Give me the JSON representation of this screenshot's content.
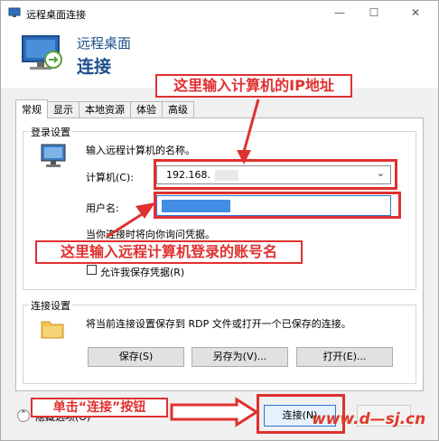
{
  "window": {
    "title": "远程桌面连接",
    "controls": {
      "minimize": "—",
      "maximize": "☐",
      "close": "✕"
    }
  },
  "banner": {
    "subtitle": "远程桌面",
    "title": "连接"
  },
  "tabs": [
    {
      "label": "常规",
      "active": true
    },
    {
      "label": "显示",
      "active": false
    },
    {
      "label": "本地资源",
      "active": false
    },
    {
      "label": "体验",
      "active": false
    },
    {
      "label": "高级",
      "active": false
    }
  ],
  "login": {
    "group_title": "登录设置",
    "prompt": "输入远程计算机的名称。",
    "computer_label": "计算机(C):",
    "computer_value": "192.168.",
    "username_label": "用户名:",
    "username_value": "",
    "note": "当你连接时将向你询问凭据。",
    "save_credentials_label": "允许我保存凭据(R)",
    "save_credentials_checked": false
  },
  "connection": {
    "group_title": "连接设置",
    "description": "将当前连接设置保存到 RDP 文件或打开一个已保存的连接。",
    "save_button": "保存(S)",
    "save_as_button": "另存为(V)...",
    "open_button": "打开(E)..."
  },
  "footer": {
    "show_options": "隐藏选项(O)",
    "connect_button": "连接(N)"
  },
  "annotations": {
    "ip_note": "这里输入计算机的IP地址",
    "user_note": "这里输入远程计算机登录的账号名",
    "connect_note": "单击“连接”按钮",
    "watermark": "www.d—sj.cn"
  },
  "colors": {
    "annotation_red": "#e03030",
    "title_blue": "#1c4f8c",
    "focus_blue": "#2c74d1"
  }
}
